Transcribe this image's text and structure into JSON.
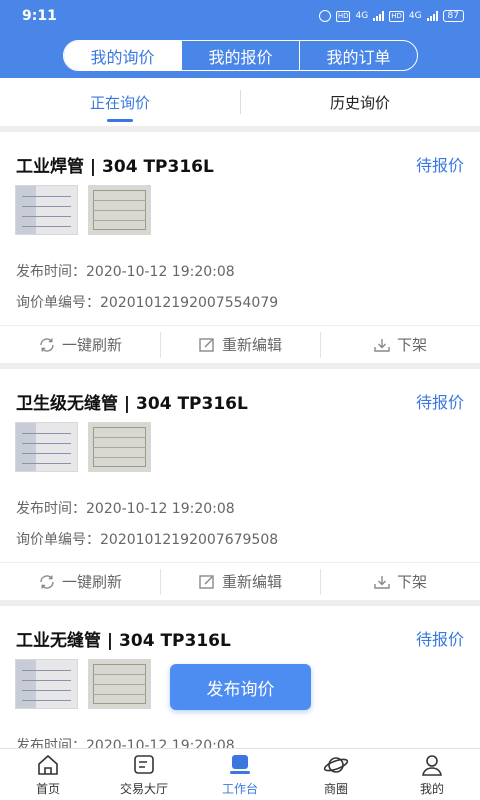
{
  "status_bar": {
    "time": "9:11",
    "network_1": "HD",
    "network_2": "4G",
    "network_3": "HD",
    "network_4": "4G",
    "battery": "87"
  },
  "segment_tabs": [
    {
      "label": "我的询价",
      "active": true
    },
    {
      "label": "我的报价",
      "active": false
    },
    {
      "label": "我的订单",
      "active": false
    }
  ],
  "sub_tabs": [
    {
      "label": "正在询价",
      "active": true
    },
    {
      "label": "历史询价",
      "active": false
    }
  ],
  "inquiries": [
    {
      "title": "工业焊管 | 304 TP316L",
      "status": "待报价",
      "publish_time": "发布时间：2020-10-12 19:20:08",
      "order_no": "询价单编号：20201012192007554079"
    },
    {
      "title": "卫生级无缝管 | 304 TP316L",
      "status": "待报价",
      "publish_time": "发布时间：2020-10-12 19:20:08",
      "order_no": "询价单编号：20201012192007679508"
    },
    {
      "title": "工业无缝管 | 304 TP316L",
      "status": "待报价",
      "publish_time": "发布时间：2020-10-12 19:20:08",
      "order_no": ""
    }
  ],
  "card_actions": {
    "refresh": "一键刷新",
    "edit": "重新编辑",
    "unlist": "下架"
  },
  "publish_button": "发布询价",
  "bottom_nav": [
    {
      "label": "首页",
      "icon": "home-icon",
      "active": false
    },
    {
      "label": "交易大厅",
      "icon": "trade-hall-icon",
      "active": false
    },
    {
      "label": "工作台",
      "icon": "workbench-icon",
      "active": true
    },
    {
      "label": "商圈",
      "icon": "planet-icon",
      "active": false
    },
    {
      "label": "我的",
      "icon": "user-icon",
      "active": false
    }
  ],
  "colors": {
    "primary": "#4a86e8",
    "accent_text": "#3a78e0",
    "publish_button": "#4d8cf0"
  }
}
